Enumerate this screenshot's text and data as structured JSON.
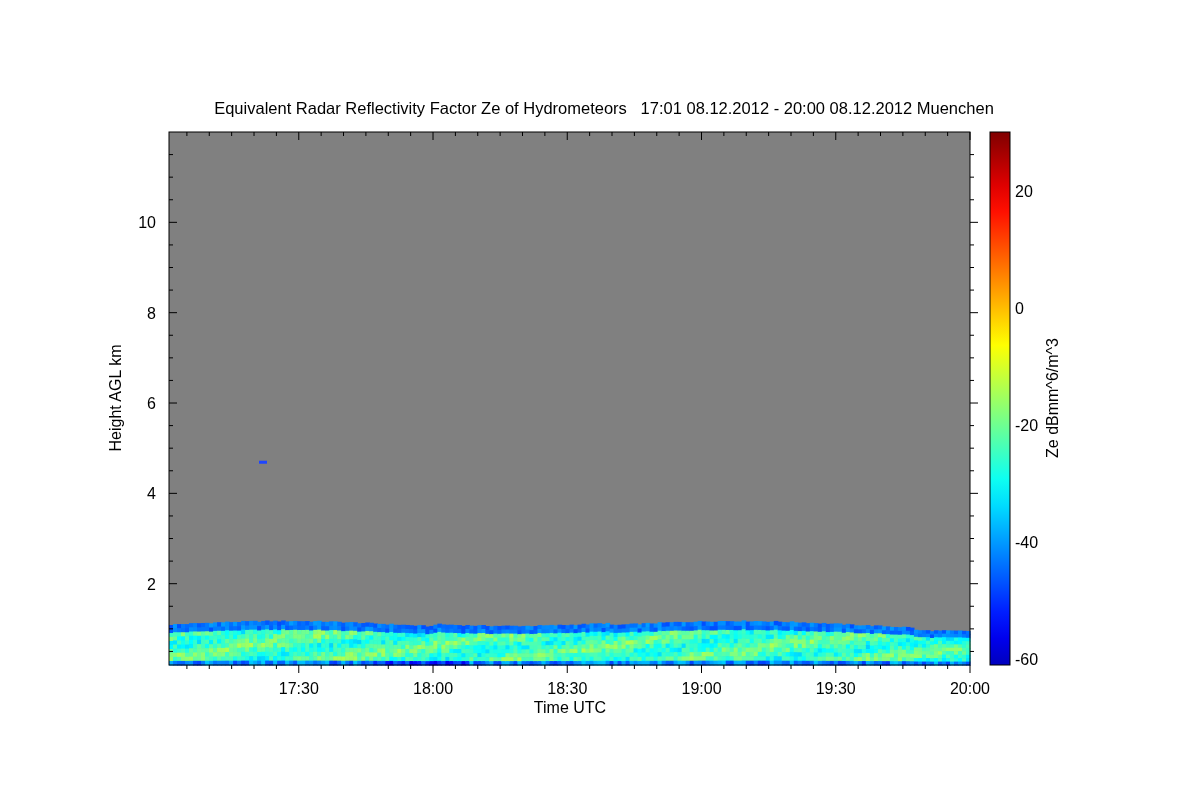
{
  "title": "Equivalent Radar Reflectivity Factor Ze of Hydrometeors   17:01 08.12.2012 - 20:00 08.12.2012 Muenchen",
  "y_axis": {
    "label": "Height AGL km",
    "ticks": [
      "10",
      "8",
      "6",
      "4",
      "2"
    ]
  },
  "x_axis": {
    "label": "Time UTC",
    "ticks": [
      "17:30",
      "18:00",
      "18:30",
      "19:00",
      "19:30",
      "20:00"
    ]
  },
  "colorbar": {
    "label": "Ze dBmm^6/m^3",
    "ticks": [
      "20",
      "0",
      "-20",
      "-40",
      "-60"
    ]
  }
}
